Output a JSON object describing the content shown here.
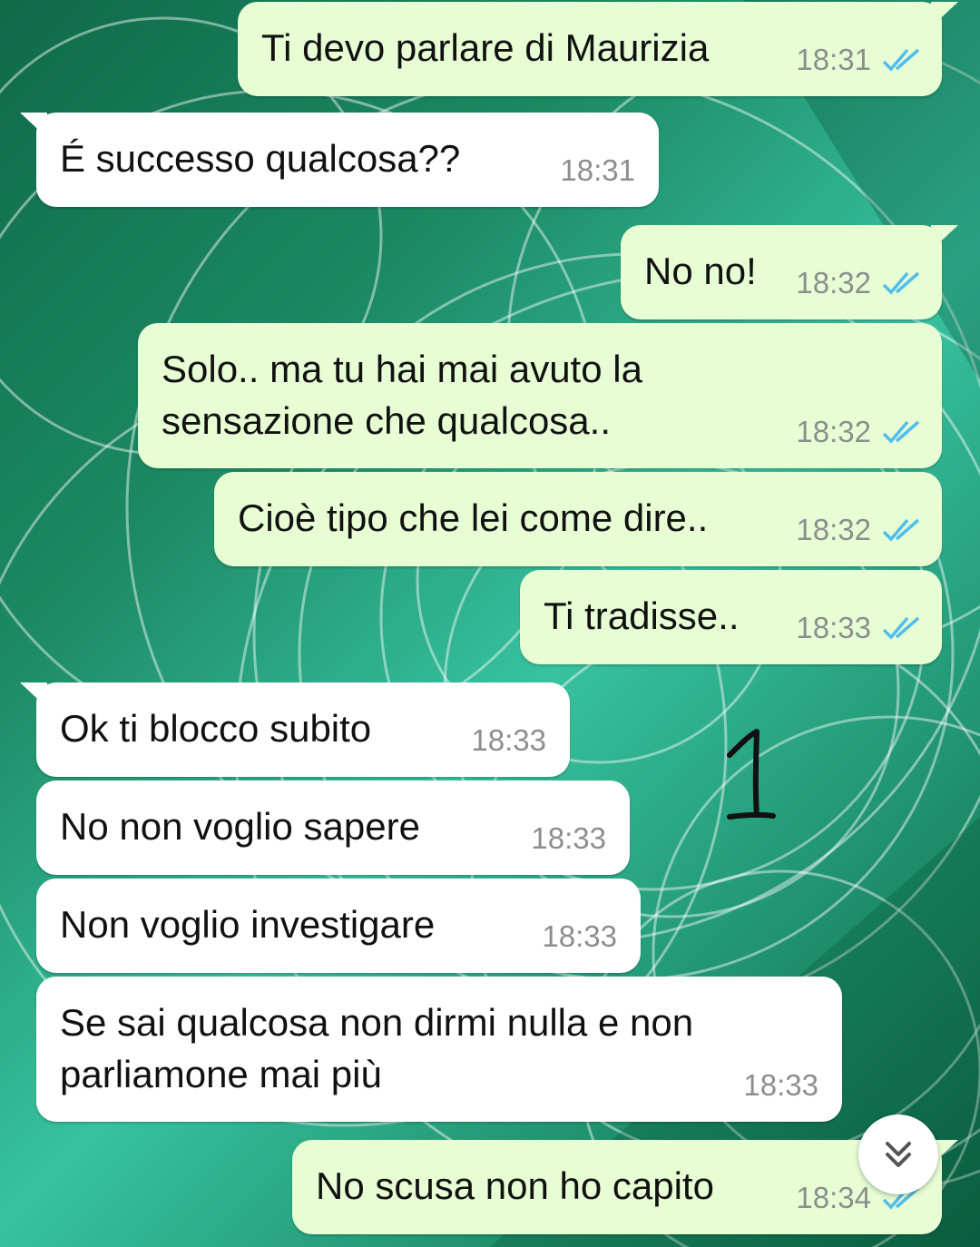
{
  "chat": {
    "messages": [
      {
        "text": "Ti devo parlare di Maurizia",
        "time": "18:31",
        "direction": "outgoing",
        "status": "read"
      },
      {
        "text": "É successo qualcosa??",
        "time": "18:31",
        "direction": "incoming"
      },
      {
        "text": "No no!",
        "time": "18:32",
        "direction": "outgoing",
        "status": "read"
      },
      {
        "text_lines": [
          "Solo.. ma tu hai mai avuto la",
          "sensazione che qualcosa.."
        ],
        "time": "18:32",
        "direction": "outgoing",
        "status": "read"
      },
      {
        "text": "Cioè tipo che lei come dire..",
        "time": "18:32",
        "direction": "outgoing",
        "status": "read"
      },
      {
        "text": "Ti tradisse..",
        "time": "18:33",
        "direction": "outgoing",
        "status": "read"
      },
      {
        "text": "Ok ti blocco subito",
        "time": "18:33",
        "direction": "incoming"
      },
      {
        "text": "No non voglio sapere",
        "time": "18:33",
        "direction": "incoming"
      },
      {
        "text": "Non voglio investigare",
        "time": "18:33",
        "direction": "incoming"
      },
      {
        "text_lines": [
          "Se sai qualcosa non dirmi nulla e non",
          "parliamone mai più"
        ],
        "time": "18:33",
        "direction": "incoming"
      },
      {
        "text": "No scusa non ho capito",
        "time": "18:34",
        "direction": "outgoing",
        "status": "read"
      }
    ]
  },
  "annotation": {
    "label": "1"
  },
  "icons": {
    "read_receipt": "double-check-icon",
    "scroll_down": "double-chevron-down-icon"
  },
  "colors": {
    "outgoing_bubble": "#e7fed5",
    "incoming_bubble": "#ffffff",
    "read_tick": "#53bdeb",
    "timestamp": "#8a8f8c"
  }
}
